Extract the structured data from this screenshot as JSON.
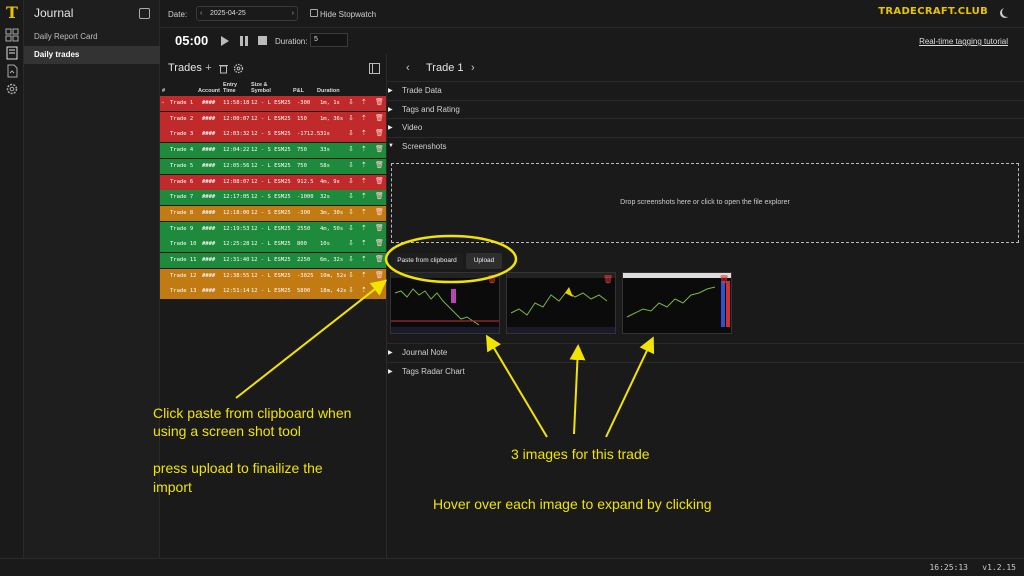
{
  "brand": {
    "logo_glyph": "T",
    "name": "TRADECRAFT.CLUB"
  },
  "sidebar": {
    "title": "Journal",
    "items": [
      {
        "label": "Daily Report Card",
        "active": false
      },
      {
        "label": "Daily trades",
        "active": true
      }
    ]
  },
  "topbar": {
    "date_label": "Date:",
    "date_value": "2025-04-25",
    "hide_stopwatch_label": "Hide Stopwatch"
  },
  "timer": {
    "time": "05:00",
    "duration_label": "Duration:",
    "duration_value": "5",
    "tutorial_link": "Real-time tagging tutorial"
  },
  "trades_panel": {
    "title": "Trades",
    "columns": [
      "#",
      "Account",
      "Entry Time",
      "Size & Symbol",
      "P&L",
      "Duration"
    ],
    "rows": [
      {
        "name": "Trade 1",
        "account": "####",
        "entry": "11:58:18",
        "size": "12 - L ESM25",
        "pnl": "-300",
        "duration": "1m, 1s",
        "color": "#c02a2a",
        "selected": true
      },
      {
        "name": "Trade 2",
        "account": "####",
        "entry": "12:00:07",
        "size": "12 - L ESM25",
        "pnl": "150",
        "duration": "1m, 36s",
        "color": "#c02a2a",
        "selected": false
      },
      {
        "name": "Trade 3",
        "account": "####",
        "entry": "12:03:32",
        "size": "12 - S ESM25",
        "pnl": "-1712.5",
        "duration": "31s",
        "color": "#c02a2a",
        "selected": false
      },
      {
        "name": "Trade 4",
        "account": "####",
        "entry": "12:04:22",
        "size": "12 - S ESM25",
        "pnl": "750",
        "duration": "33s",
        "color": "#1e8a3c",
        "selected": false
      },
      {
        "name": "Trade 5",
        "account": "####",
        "entry": "12:05:56",
        "size": "12 - L ESM25",
        "pnl": "750",
        "duration": "58s",
        "color": "#1e8a3c",
        "selected": false
      },
      {
        "name": "Trade 6",
        "account": "####",
        "entry": "12:08:07",
        "size": "12 - L ESM25",
        "pnl": "912.5",
        "duration": "4m, 9s",
        "color": "#c02a2a",
        "selected": false
      },
      {
        "name": "Trade 7",
        "account": "####",
        "entry": "12:17:05",
        "size": "12 - S ESM25",
        "pnl": "-1000",
        "duration": "32s",
        "color": "#1e8a3c",
        "selected": false
      },
      {
        "name": "Trade 8",
        "account": "####",
        "entry": "12:18:00",
        "size": "12 - S ESM25",
        "pnl": "-300",
        "duration": "3m, 30s",
        "color": "#c27a12",
        "selected": false
      },
      {
        "name": "Trade 9",
        "account": "####",
        "entry": "12:19:53",
        "size": "12 - L ESM25",
        "pnl": "2550",
        "duration": "4m, 50s",
        "color": "#1e8a3c",
        "selected": false
      },
      {
        "name": "Trade 10",
        "account": "####",
        "entry": "12:25:28",
        "size": "12 - L ESM25",
        "pnl": "800",
        "duration": "10s",
        "color": "#1e8a3c",
        "selected": false
      },
      {
        "name": "Trade 11",
        "account": "####",
        "entry": "12:31:40",
        "size": "12 - L ESM25",
        "pnl": "2250",
        "duration": "6m, 32s",
        "color": "#1e8a3c",
        "selected": false
      },
      {
        "name": "Trade 12",
        "account": "####",
        "entry": "12:38:55",
        "size": "12 - L ESM25",
        "pnl": "-3025",
        "duration": "10m, 52s",
        "color": "#c27a12",
        "selected": false
      },
      {
        "name": "Trade 13",
        "account": "####",
        "entry": "12:51:14",
        "size": "12 - L ESM25",
        "pnl": "5800",
        "duration": "18m, 42s",
        "color": "#c27a12",
        "selected": false
      }
    ]
  },
  "detail": {
    "title": "Trade 1",
    "sections": [
      "Trade Data",
      "Tags and Rating",
      "Video",
      "Screenshots"
    ],
    "drop_text": "Drop screenshots here or click to open the file explorer",
    "paste_label": "Paste from clipboard",
    "upload_label": "Upload",
    "thumbnail_count": 3,
    "lower_sections": [
      "Journal Note",
      "Tags Radar Chart"
    ]
  },
  "annotations": {
    "left_1": "Click paste from clipboard when",
    "left_2": "using a screen shot tool",
    "left_3": "press upload to finailize the",
    "left_4": "import",
    "mid": "3 images for this trade",
    "bottom": "Hover over each image to expand by clicking"
  },
  "footer": {
    "clock": "16:25:13",
    "version": "v1.2.15"
  },
  "colors": {
    "accent": "#e8c400",
    "loss": "#c02a2a",
    "win": "#1e8a3c",
    "be": "#c27a12",
    "annotation": "#f0e400"
  }
}
